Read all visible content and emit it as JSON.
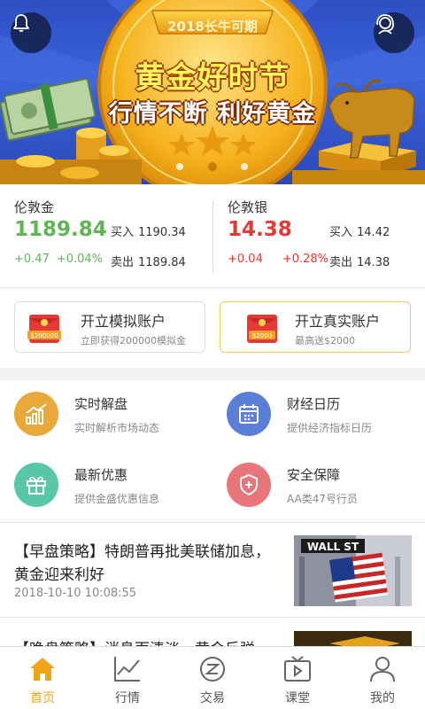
{
  "banner": {
    "top_label": "2018长牛可期",
    "title": "黄金好时节",
    "subtitle": "行情不断 利好黄金"
  },
  "quotes": {
    "gold": {
      "name": "伦敦金",
      "price": "1189.84",
      "change": "+0.47",
      "change_pct": "+0.04%",
      "buy_label": "买入",
      "buy": "1190.34",
      "sell_label": "卖出",
      "sell": "1189.84",
      "color": "#5fb554"
    },
    "silver": {
      "name": "伦敦银",
      "price": "14.38",
      "change": "+0.04",
      "change_pct": "+0.28%",
      "buy_label": "买入",
      "buy": "14.42",
      "sell_label": "卖出",
      "sell": "14.38",
      "color": "#e53935"
    }
  },
  "accounts": {
    "demo": {
      "title": "开立模拟账户",
      "subtitle": "立即获得200000模拟金",
      "badge": "$200000"
    },
    "real": {
      "title": "开立真实账户",
      "subtitle": "最高送$2000",
      "badge": "$2000"
    }
  },
  "features": [
    {
      "title": "实时解盘",
      "subtitle": "实时解析市场动态",
      "icon": "chart-bars-icon",
      "color": "#e8a93a"
    },
    {
      "title": "财经日历",
      "subtitle": "提供经济指标日历",
      "icon": "calendar-icon",
      "color": "#5b7fd6"
    },
    {
      "title": "最新优惠",
      "subtitle": "提供金盛优惠信息",
      "icon": "gift-icon",
      "color": "#58c7a8"
    },
    {
      "title": "安全保障",
      "subtitle": "AA类47号行员",
      "icon": "shield-icon",
      "color": "#e8757a"
    }
  ],
  "news": [
    {
      "title": "【早盘策略】特朗普再批美联储加息，黄金迎来利好",
      "time": "2018-10-10 10:08:55",
      "thumb_text": "WALL ST"
    },
    {
      "title": "【晚盘策略】消息面清淡，黄金反弹"
    }
  ],
  "tabs": [
    {
      "label": "首页",
      "icon": "home-icon"
    },
    {
      "label": "行情",
      "icon": "line-chart-icon"
    },
    {
      "label": "交易",
      "icon": "trade-icon"
    },
    {
      "label": "课堂",
      "icon": "tv-icon"
    },
    {
      "label": "我的",
      "icon": "user-icon"
    }
  ],
  "colors": {
    "accent": "#f0a419",
    "gain_gold": "#5fb554",
    "gain_silver": "#e53935"
  }
}
